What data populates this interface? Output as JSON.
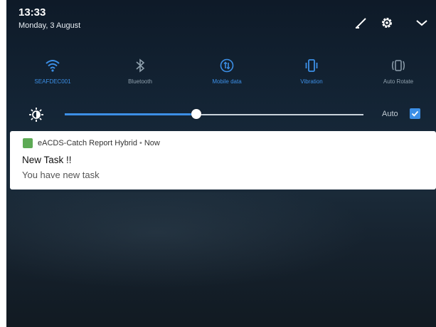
{
  "status": {
    "time": "13:33",
    "date": "Monday, 3 August"
  },
  "header_icons": [
    "edit-icon",
    "gear-icon",
    "chevron-down-icon"
  ],
  "quick_tiles": [
    {
      "icon": "wifi-icon",
      "label": "SEAFDEC001",
      "active": true
    },
    {
      "icon": "bluetooth-icon",
      "label": "Bluetooth",
      "active": false
    },
    {
      "icon": "mobile-data-icon",
      "label": "Mobile data",
      "active": true
    },
    {
      "icon": "vibration-icon",
      "label": "Vibration",
      "active": true
    },
    {
      "icon": "auto-rotate-icon",
      "label": "Auto Rotate",
      "active": false
    }
  ],
  "brightness": {
    "level_fraction": 0.44,
    "auto_label": "Auto",
    "auto_checked": true
  },
  "notification": {
    "app_name": "eACDS-Catch Report Hybrid",
    "separator": "•",
    "when": "Now",
    "title": "New Task !!",
    "text": "You have new task"
  },
  "colors": {
    "accent": "#3c8fe6",
    "inactive": "#8fa0ad",
    "panel_bg": "#142536",
    "app_icon": "#5daa55"
  }
}
